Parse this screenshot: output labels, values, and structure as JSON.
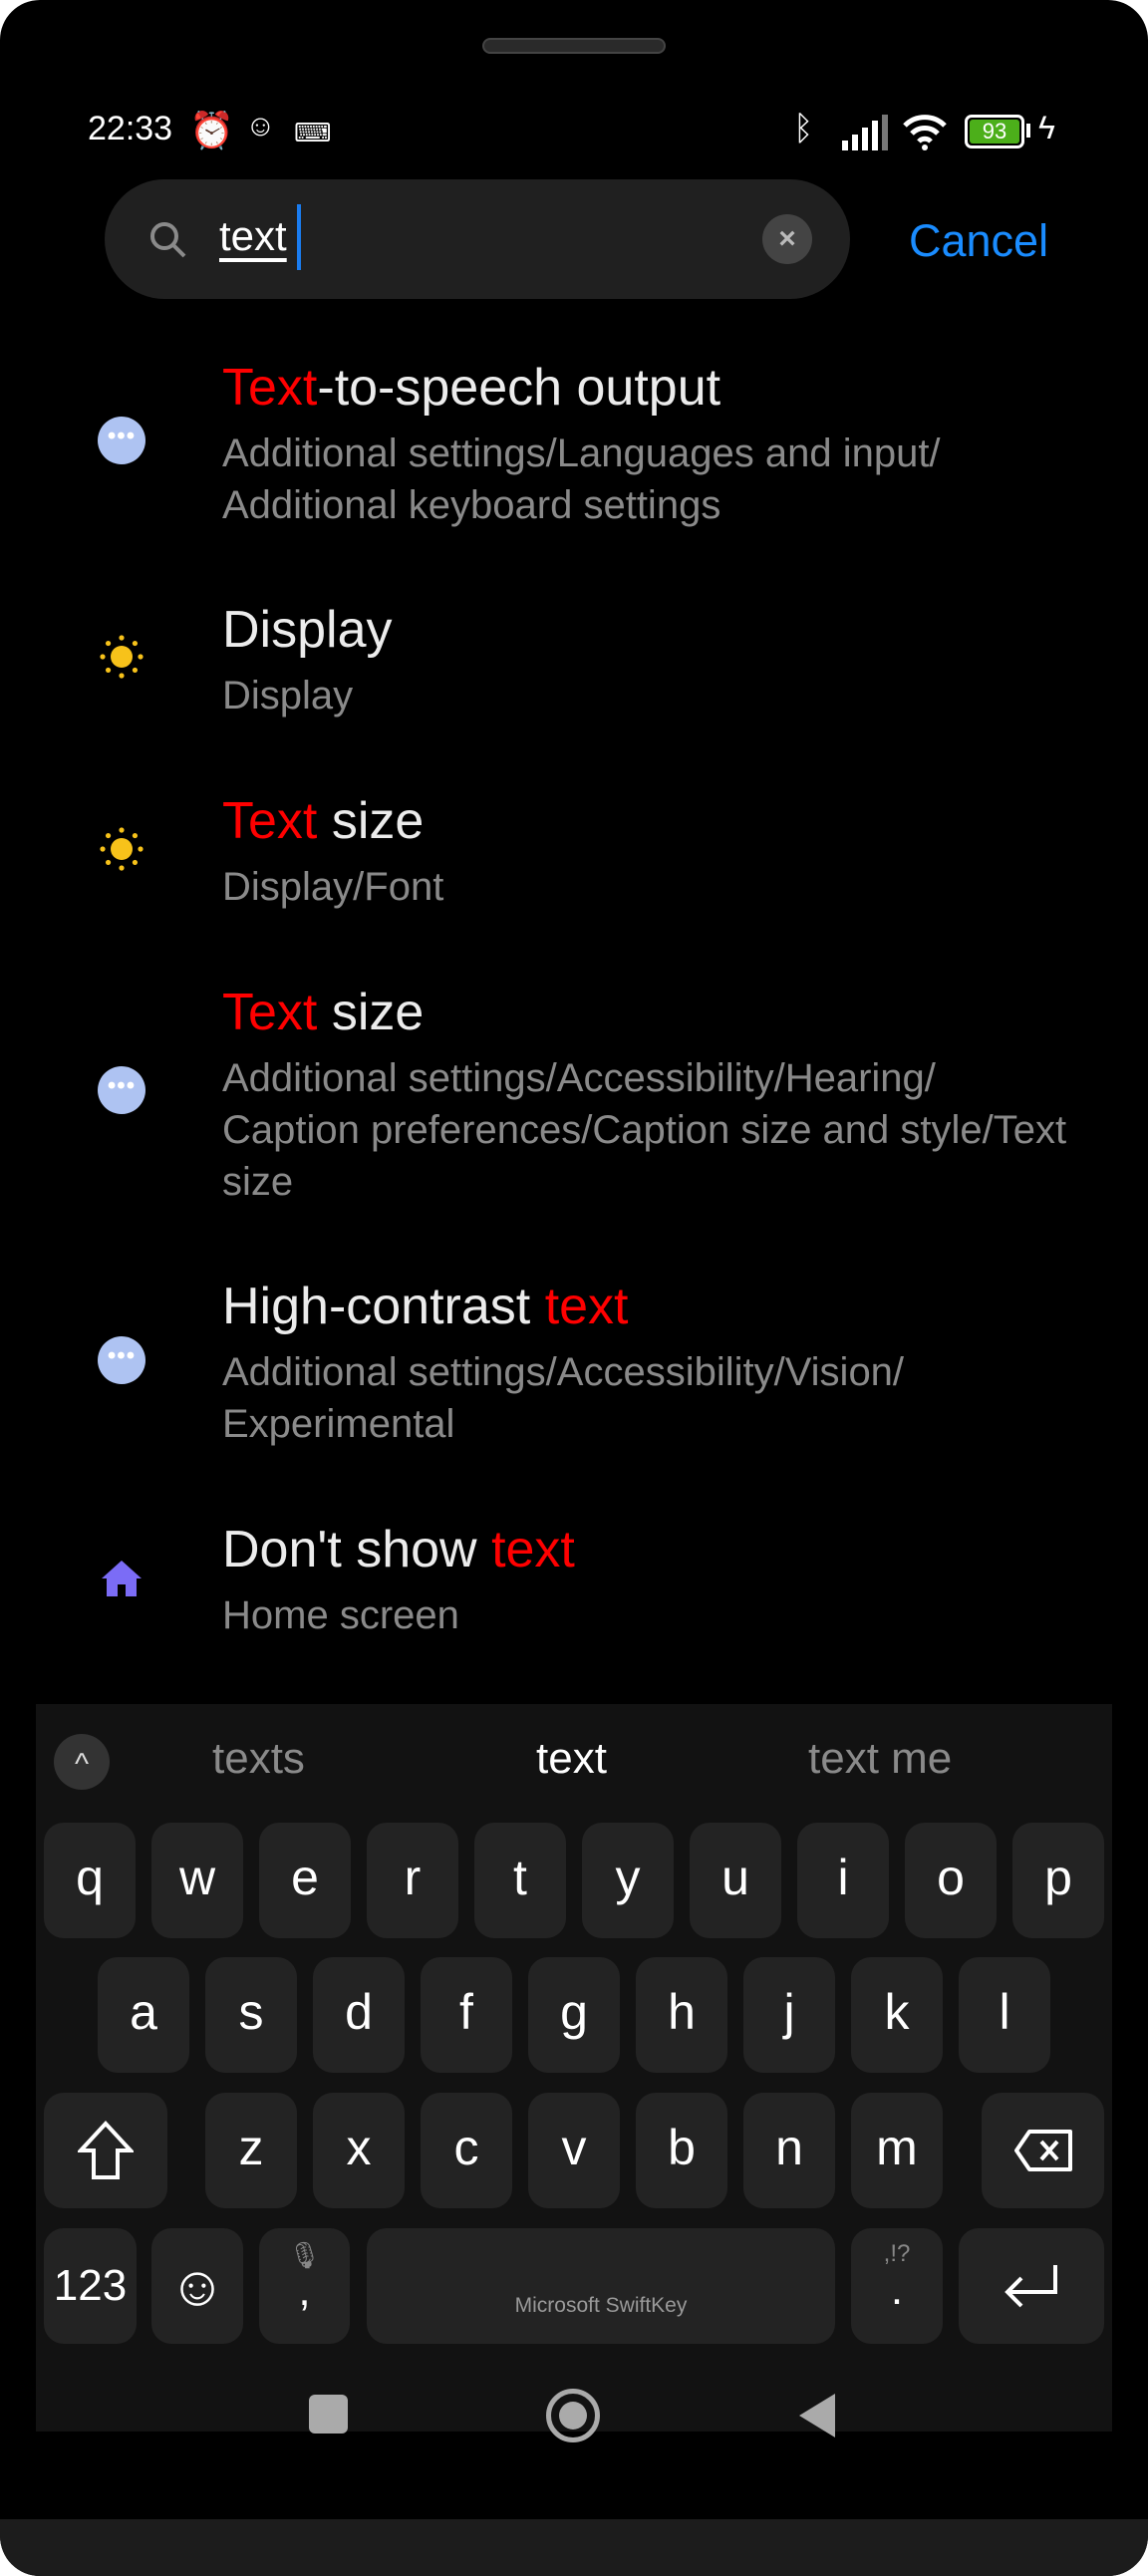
{
  "status_bar": {
    "time": "22:33",
    "battery": "93",
    "icons": [
      "alarm-icon",
      "app-notification-icon",
      "keyboard-icon",
      "bluetooth-icon",
      "signal-icon",
      "wifi-icon",
      "battery-icon",
      "charging-icon"
    ]
  },
  "search": {
    "query": "text",
    "cancel_label": "Cancel"
  },
  "results": [
    {
      "icon": "more-dots-icon",
      "title_parts": [
        {
          "t": "Text",
          "hl": true
        },
        {
          "t": "-to-speech output",
          "hl": false
        }
      ],
      "subtitle": "Additional settings/Languages and input/ Additional keyboard settings"
    },
    {
      "icon": "sun-icon",
      "title_parts": [
        {
          "t": "Display",
          "hl": false
        }
      ],
      "subtitle": "Display"
    },
    {
      "icon": "sun-icon",
      "title_parts": [
        {
          "t": "Text",
          "hl": true
        },
        {
          "t": " size",
          "hl": false
        }
      ],
      "subtitle": "Display/Font"
    },
    {
      "icon": "more-dots-icon",
      "title_parts": [
        {
          "t": "Text",
          "hl": true
        },
        {
          "t": " size",
          "hl": false
        }
      ],
      "subtitle": "Additional settings/Accessibility/Hearing/ Caption preferences/Caption size and style/Text size"
    },
    {
      "icon": "more-dots-icon",
      "title_parts": [
        {
          "t": "High-contrast ",
          "hl": false
        },
        {
          "t": "text",
          "hl": true
        }
      ],
      "subtitle": "Additional settings/Accessibility/Vision/ Experimental"
    },
    {
      "icon": "home-icon",
      "title_parts": [
        {
          "t": "Don't show ",
          "hl": false
        },
        {
          "t": "text",
          "hl": true
        }
      ],
      "subtitle": "Home screen"
    }
  ],
  "keyboard": {
    "suggestions": [
      "texts",
      "text",
      "text me"
    ],
    "row1": [
      "q",
      "w",
      "e",
      "r",
      "t",
      "y",
      "u",
      "i",
      "o",
      "p"
    ],
    "row2": [
      "a",
      "s",
      "d",
      "f",
      "g",
      "h",
      "j",
      "k",
      "l"
    ],
    "row3": [
      "z",
      "x",
      "c",
      "v",
      "b",
      "n",
      "m"
    ],
    "numbers_label": "123",
    "comma": ",",
    "period": ".",
    "punct_hint": ",!?",
    "space_label": "Microsoft SwiftKey"
  },
  "colors": {
    "highlight": "#ff0000",
    "accent": "#1a8cff",
    "battery": "#4caf1a"
  }
}
